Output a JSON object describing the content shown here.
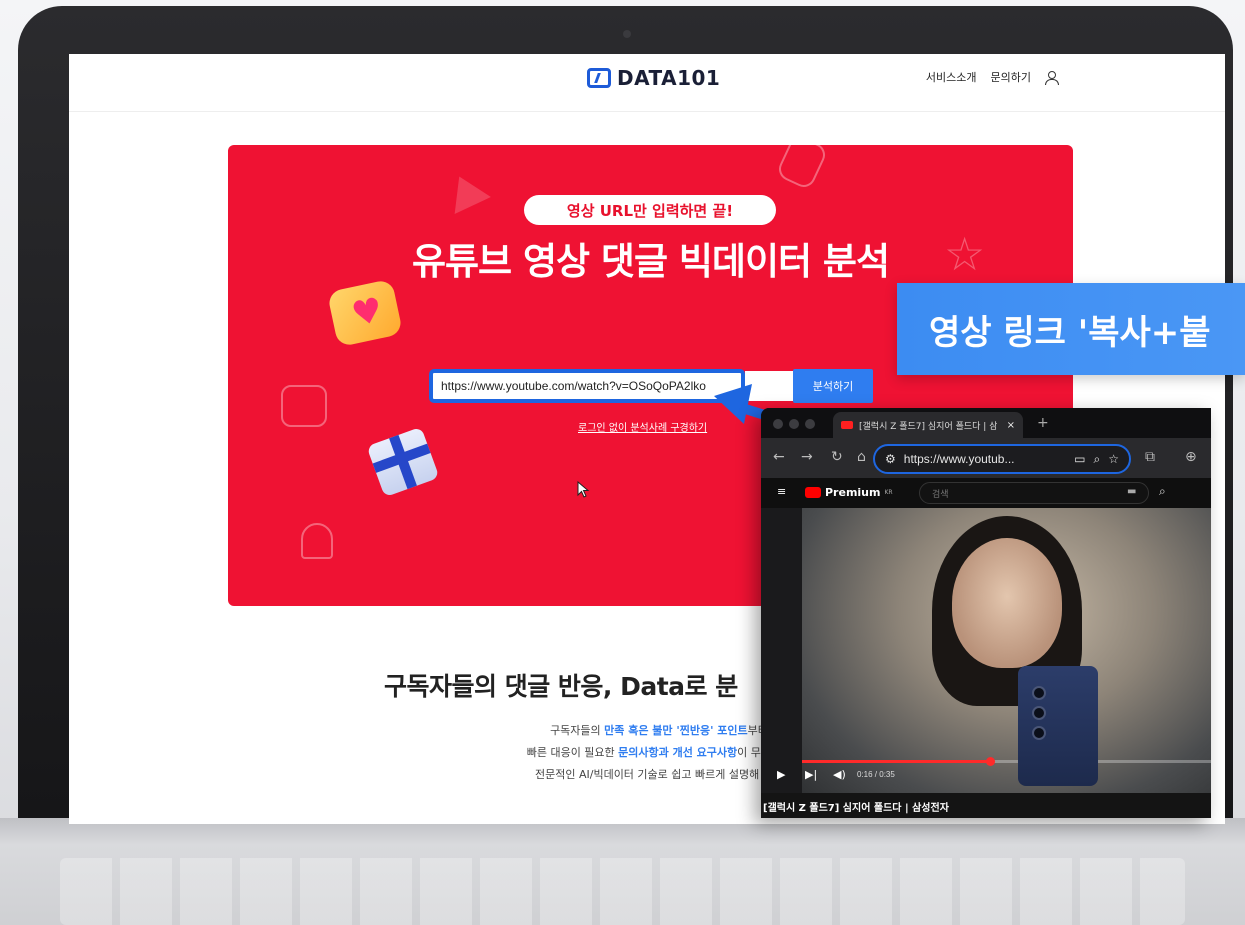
{
  "site": {
    "logo_text": "DATA101",
    "nav": {
      "service": "서비스소개",
      "contact": "문의하기"
    }
  },
  "hero": {
    "pill": "영상 URL만 입력하면 끝!",
    "title": "유튜브 영상 댓글 빅데이터 분석",
    "input_value": "https://www.youtube.com/watch?v=OSoQoPA2lko",
    "analyze_button": "분석하기",
    "sample_link": "로그인 없이 분석사례 구경하기"
  },
  "section": {
    "title": "구독자들의 댓글 반응, Data로 분",
    "line1_prefix": "구독자들의 ",
    "line1_highlight": "만족 혹은 불만 '찐반응' 포인트",
    "line1_suffix": "부터",
    "line2_prefix": "빠른 대응이 필요한 ",
    "line2_highlight": "문의사항과 개선 요구사항",
    "line2_suffix": "이 무엇인지",
    "line3": "전문적인 AI/빅데이터 기술로 쉽고 빠르게 설명해 드려"
  },
  "callout": {
    "text": "영상 링크 '복사+붙"
  },
  "browser": {
    "tab_title": "[갤럭시 Z 폴드7] 심지어 폴드다 | 삼",
    "tab_close": "×",
    "tab_new": "+",
    "address": "https://www.youtub...",
    "yt_logo": "Premium",
    "yt_region": "KR",
    "search_placeholder": "검색",
    "timecode": "0:16 / 0:35",
    "video_title": "[갤럭시 Z 폴드7] 심지어 폴드다 | 삼성전자",
    "progress": 0.46
  },
  "colors": {
    "hero_red": "#ef1233",
    "accent_blue": "#2f7df0",
    "callout_blue": "#3c8cf2"
  }
}
